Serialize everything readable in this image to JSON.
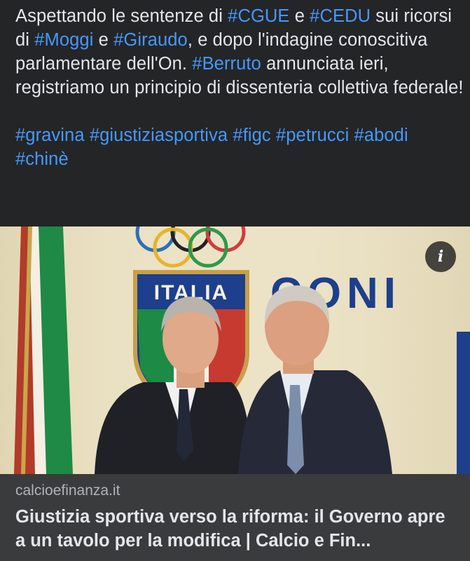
{
  "post": {
    "line1_parts": [
      {
        "t": "Aspettando le sentenze di ",
        "k": "word"
      },
      {
        "t": "#CGUE",
        "k": "tag"
      },
      {
        "t": " e ",
        "k": "word"
      },
      {
        "t": "#CEDU",
        "k": "tag"
      },
      {
        "t": " sui ricorsi di ",
        "k": "word"
      },
      {
        "t": "#Moggi",
        "k": "tag"
      },
      {
        "t": " e ",
        "k": "word"
      },
      {
        "t": "#Giraudo",
        "k": "tag"
      },
      {
        "t": ", e dopo l'indagine conoscitiva parlamentare dell'On. ",
        "k": "word"
      },
      {
        "t": "#Berruto",
        "k": "tag"
      },
      {
        "t": " annunciata ieri, registriamo un principio di dissenteria collettiva federale!",
        "k": "word"
      }
    ],
    "hashtags": [
      "#gravina",
      "#giustiziasportiva",
      "#figc",
      "#petrucci",
      "#abodi",
      "#chinè"
    ]
  },
  "link_preview": {
    "info_icon_label": "i",
    "image_text": {
      "crest": "ITALIA",
      "wordmark": "CONI"
    },
    "domain": "calcioefinanza.it",
    "headline": "Giustizia sportiva verso la riforma: il Governo apre a un tavolo per la modifica | Calcio e Fin..."
  },
  "colors": {
    "background": "#242526",
    "hashtag": "#4599ff",
    "text": "#e4e6eb",
    "card_meta_bg": "#3a3b3c"
  }
}
